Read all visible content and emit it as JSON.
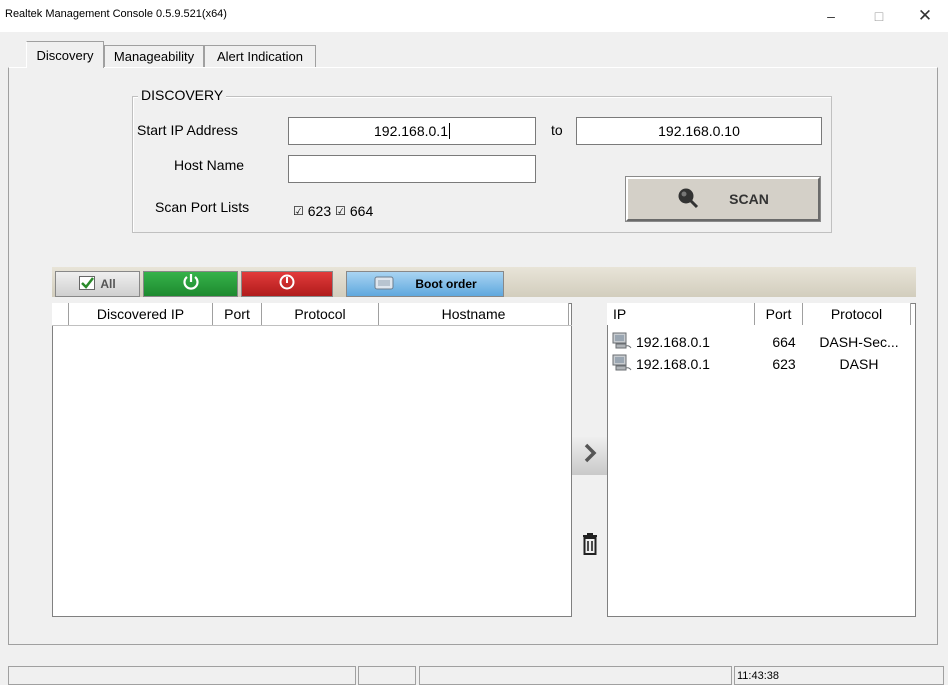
{
  "window": {
    "title": "Realtek Management Console 0.5.9.521(x64)",
    "minimize": "–",
    "maximize": "□",
    "close": "✕"
  },
  "tabs": [
    "Discovery",
    "Manageability",
    "Alert Indication"
  ],
  "discovery": {
    "group_label": "DISCOVERY",
    "start_ip_label": "Start IP Address",
    "start_ip_value": "192.168.0.1",
    "to_label": "to",
    "end_ip_value": "192.168.0.10",
    "host_name_label": "Host Name",
    "host_name_value": "",
    "scan_port_label": "Scan Port Lists",
    "port1_check": "☑",
    "port1": "623",
    "port2_check": "☑",
    "port2": "664",
    "scan_button": "SCAN"
  },
  "toolbar": {
    "all_label": "All",
    "boot_order_label": "Boot order"
  },
  "left_table": {
    "columns": [
      "Discovered IP",
      "Port",
      "Protocol",
      "Hostname"
    ]
  },
  "right_table": {
    "columns": [
      "IP",
      "Port",
      "Protocol"
    ],
    "rows": [
      {
        "ip": "192.168.0.1",
        "port": "664",
        "protocol": "DASH-Sec..."
      },
      {
        "ip": "192.168.0.1",
        "port": "623",
        "protocol": "DASH"
      }
    ]
  },
  "statusbar": {
    "time": "11:43:38"
  },
  "colors": {
    "power_green": "#2aa33d",
    "reset_red": "#cc2a2a",
    "boot_blue": "#6fb3e3"
  }
}
